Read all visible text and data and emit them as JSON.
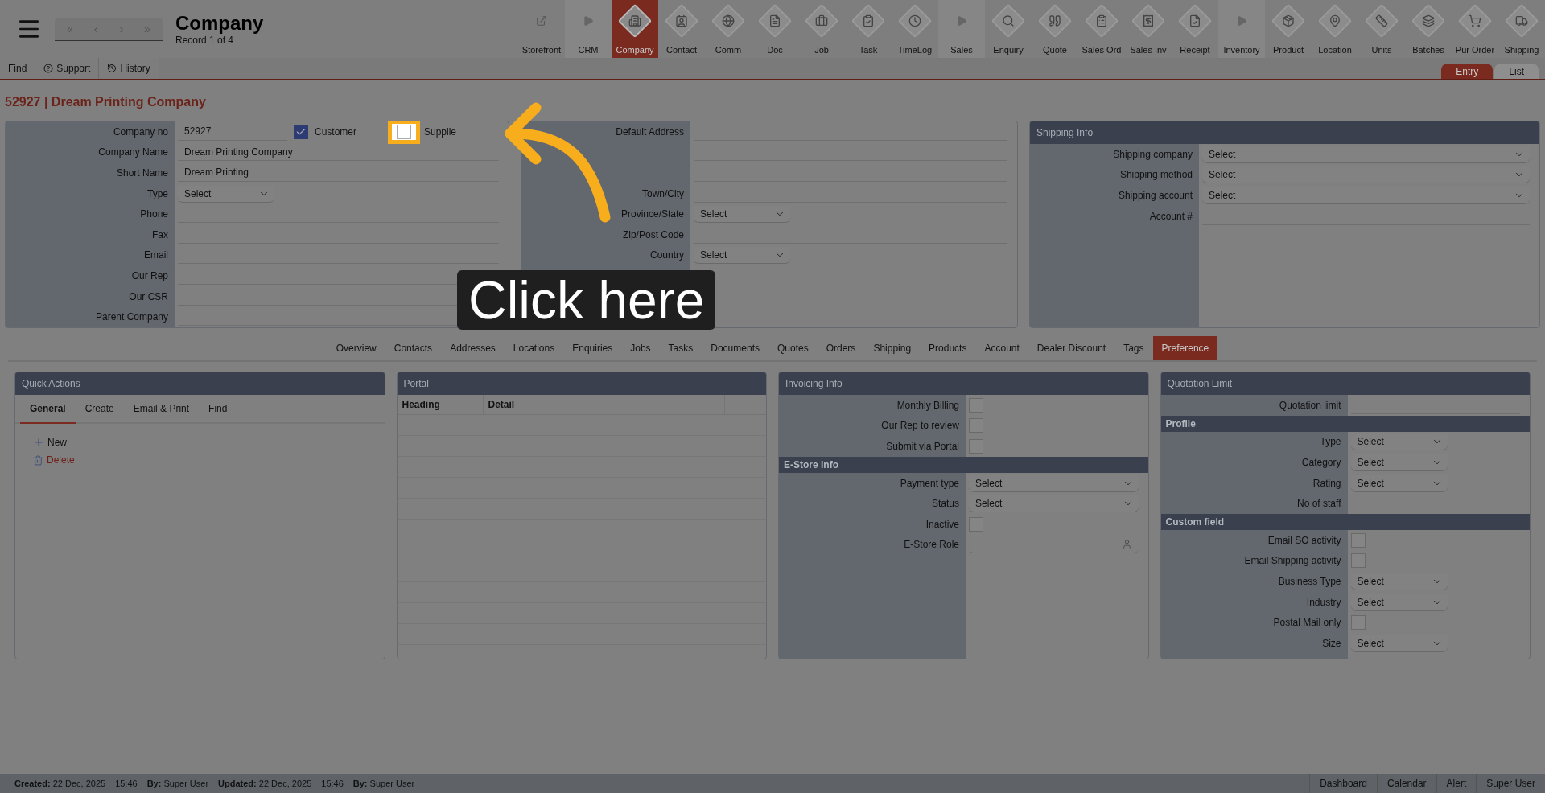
{
  "header": {
    "title": "Company",
    "record": "Record 1 of 4",
    "nav": [
      "«",
      "‹",
      "›",
      "»"
    ]
  },
  "modules": [
    {
      "label": "Storefront",
      "kind": "link",
      "selected": false
    },
    {
      "label": "CRM",
      "kind": "section",
      "selected": false
    },
    {
      "label": "Company",
      "kind": "module",
      "selected": true
    },
    {
      "label": "Contact",
      "kind": "module",
      "selected": false
    },
    {
      "label": "Comm",
      "kind": "module",
      "selected": false
    },
    {
      "label": "Doc",
      "kind": "module",
      "selected": false
    },
    {
      "label": "Job",
      "kind": "module",
      "selected": false
    },
    {
      "label": "Task",
      "kind": "module",
      "selected": false
    },
    {
      "label": "TimeLog",
      "kind": "module",
      "selected": false
    },
    {
      "label": "Sales",
      "kind": "section",
      "selected": false
    },
    {
      "label": "Enquiry",
      "kind": "module",
      "selected": false
    },
    {
      "label": "Quote",
      "kind": "module",
      "selected": false
    },
    {
      "label": "Sales Ord",
      "kind": "module",
      "selected": false
    },
    {
      "label": "Sales Inv",
      "kind": "module",
      "selected": false
    },
    {
      "label": "Receipt",
      "kind": "module",
      "selected": false
    },
    {
      "label": "Inventory",
      "kind": "section",
      "selected": false
    },
    {
      "label": "Product",
      "kind": "module",
      "selected": false
    },
    {
      "label": "Location",
      "kind": "module",
      "selected": false
    },
    {
      "label": "Units",
      "kind": "module",
      "selected": false
    },
    {
      "label": "Batches",
      "kind": "module",
      "selected": false
    },
    {
      "label": "Pur Order",
      "kind": "module",
      "selected": false
    },
    {
      "label": "Shipping",
      "kind": "module",
      "selected": false
    }
  ],
  "subbar": {
    "actions": [
      {
        "label": "Find",
        "kind": "plain"
      },
      {
        "label": "Support",
        "kind": "help"
      },
      {
        "label": "History",
        "kind": "history"
      }
    ],
    "views": [
      {
        "label": "Entry",
        "selected": true
      },
      {
        "label": "List",
        "selected": false
      }
    ]
  },
  "record_title": "52927 | Dream Printing Company",
  "company_panel": {
    "sections": [
      {
        "rows": [
          {
            "label": "Company no",
            "kind": "flags",
            "value": "52927",
            "flags": [
              {
                "label": "Customer",
                "checked": true,
                "highlighted": false
              },
              {
                "label": "Supplie",
                "checked": false,
                "highlighted": true
              }
            ]
          },
          {
            "label": "Company Name",
            "kind": "text",
            "value": "Dream Printing Company"
          },
          {
            "label": "Short Name",
            "kind": "text",
            "value": "Dream Printing"
          },
          {
            "label": "Type",
            "kind": "select",
            "value": "Select"
          },
          {
            "label": "Phone",
            "kind": "text"
          },
          {
            "label": "Fax",
            "kind": "text"
          },
          {
            "label": "Email",
            "kind": "text"
          },
          {
            "label": "Our Rep",
            "kind": "text"
          },
          {
            "label": "Our CSR",
            "kind": "text"
          },
          {
            "label": "Parent Company",
            "kind": "text"
          }
        ]
      }
    ]
  },
  "address_panel": {
    "sections": [
      {
        "rows": [
          {
            "label": "Default Address",
            "kind": "text"
          },
          {
            "kind": "text"
          },
          {
            "kind": "text"
          },
          {
            "label": "Town/City",
            "kind": "text"
          },
          {
            "label": "Province/State",
            "kind": "select",
            "value": "Select"
          },
          {
            "label": "Zip/Post Code",
            "kind": "text"
          },
          {
            "label": "Country",
            "kind": "select",
            "value": "Select"
          }
        ]
      }
    ]
  },
  "shipping_panel": {
    "title": "Shipping Info",
    "sections": [
      {
        "rows": [
          {
            "label": "Shipping company",
            "kind": "dropdown",
            "value": "Select"
          },
          {
            "label": "Shipping method",
            "kind": "dropdown",
            "value": "Select"
          },
          {
            "label": "Shipping account",
            "kind": "dropdown",
            "value": "Select"
          },
          {
            "label": "Account #",
            "kind": "text"
          }
        ]
      }
    ]
  },
  "tabs": [
    {
      "label": "Overview",
      "selected": false
    },
    {
      "label": "Contacts",
      "selected": false
    },
    {
      "label": "Addresses",
      "selected": false
    },
    {
      "label": "Locations",
      "selected": false
    },
    {
      "label": "Enquiries",
      "selected": false
    },
    {
      "label": "Jobs",
      "selected": false
    },
    {
      "label": "Tasks",
      "selected": false
    },
    {
      "label": "Documents",
      "selected": false
    },
    {
      "label": "Quotes",
      "selected": false
    },
    {
      "label": "Orders",
      "selected": false
    },
    {
      "label": "Shipping",
      "selected": false
    },
    {
      "label": "Products",
      "selected": false
    },
    {
      "label": "Account",
      "selected": false
    },
    {
      "label": "Dealer Discount",
      "selected": false
    },
    {
      "label": "Tags",
      "selected": false
    },
    {
      "label": "Preference",
      "selected": true
    }
  ],
  "quick_actions": {
    "title": "Quick Actions",
    "tabs": [
      {
        "label": "General",
        "selected": true
      },
      {
        "label": "Create",
        "selected": false
      },
      {
        "label": "Email & Print",
        "selected": false
      },
      {
        "label": "Find",
        "selected": false
      }
    ],
    "actions": [
      {
        "label": "New",
        "kind": "new"
      },
      {
        "label": "Delete",
        "kind": "delete"
      }
    ]
  },
  "portal": {
    "title": "Portal",
    "columns": [
      "Heading",
      "Detail"
    ]
  },
  "invoicing_panel": {
    "title": "Invoicing Info",
    "sections": [
      {
        "rows": [
          {
            "label": "Monthly Billing",
            "kind": "check",
            "checked": false
          },
          {
            "label": "Our Rep to review",
            "kind": "check",
            "checked": false
          },
          {
            "label": "Submit via Portal",
            "kind": "check",
            "checked": false
          }
        ]
      },
      {
        "heading": "E-Store Info",
        "rows": [
          {
            "label": "Payment type",
            "kind": "dropdown",
            "value": "Select"
          },
          {
            "label": "Status",
            "kind": "dropdown",
            "value": "Select"
          },
          {
            "label": "Inactive",
            "kind": "check",
            "checked": false
          },
          {
            "label": "E-Store Role",
            "kind": "lookup"
          }
        ]
      }
    ]
  },
  "quotation_panel": {
    "title": "Quotation Limit",
    "sections": [
      {
        "rows": [
          {
            "label": "Quotation limit",
            "kind": "text"
          }
        ]
      },
      {
        "heading": "Profile",
        "rows": [
          {
            "label": "Type",
            "kind": "select",
            "value": "Select"
          },
          {
            "label": "Category",
            "kind": "select",
            "value": "Select"
          },
          {
            "label": "Rating",
            "kind": "select",
            "value": "Select"
          },
          {
            "label": "No of staff",
            "kind": "text"
          }
        ]
      },
      {
        "heading": "Custom field",
        "rows": [
          {
            "label": "Email SO activity",
            "kind": "check",
            "checked": false
          },
          {
            "label": "Email Shipping activity",
            "kind": "check",
            "checked": false
          },
          {
            "label": "Business Type",
            "kind": "select",
            "value": "Select"
          },
          {
            "label": "Industry",
            "kind": "select",
            "value": "Select"
          },
          {
            "label": "Postal Mail only",
            "kind": "check",
            "checked": false
          },
          {
            "label": "Size",
            "kind": "select",
            "value": "Select"
          }
        ]
      }
    ]
  },
  "footer": {
    "info": [
      "**Created:** 22 Dec, 2025",
      "15:46",
      "**By:** Super User",
      "**Updated:** 22 Dec, 2025",
      "15:46",
      "**By:** Super User"
    ],
    "links": [
      "Dashboard",
      "Calendar",
      "Alert",
      "Super User"
    ]
  },
  "tutorial": {
    "callout": "Click here"
  }
}
